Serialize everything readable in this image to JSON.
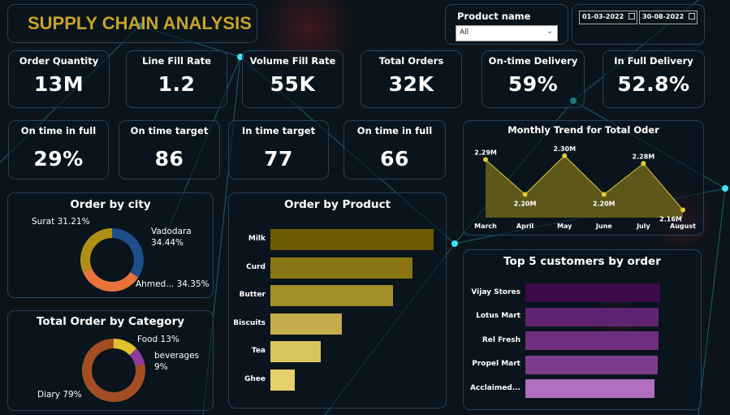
{
  "header": {
    "title": "SUPPLY CHAIN ANALYSIS"
  },
  "filter": {
    "label": "Product name",
    "value": "All"
  },
  "dates": {
    "start": "01-03-2022",
    "end": "30-08-2022"
  },
  "kpis_top": [
    {
      "title": "Order Quantity",
      "value": "13M"
    },
    {
      "title": "Line Fill Rate",
      "value": "1.2"
    },
    {
      "title": "Volume Fill Rate",
      "value": "55K"
    },
    {
      "title": "Total Orders",
      "value": "32K"
    },
    {
      "title": "On-time Delivery",
      "value": "59%"
    },
    {
      "title": "In Full Delivery",
      "value": "52.8%"
    }
  ],
  "kpis_bottom": [
    {
      "title": "On time in full",
      "value": "29%"
    },
    {
      "title": "On time target",
      "value": "86"
    },
    {
      "title": "In time target",
      "value": "77"
    },
    {
      "title": "On time in full",
      "value": "66"
    }
  ],
  "colors": {
    "title_gold": "#c9a227",
    "yellow": "#d8c547",
    "purple": "#9b4fa0"
  },
  "chart_data": [
    {
      "type": "area",
      "title": "Monthly Trend for Total Oder",
      "categories": [
        "March",
        "April",
        "May",
        "June",
        "July",
        "August"
      ],
      "values": [
        2.29,
        2.2,
        2.3,
        2.2,
        2.28,
        2.16
      ],
      "data_labels": [
        "2.29M",
        "2.20M",
        "2.30M",
        "2.20M",
        "2.28M",
        "2.16M"
      ],
      "ylim": [
        2.14,
        2.31
      ]
    },
    {
      "type": "pie",
      "title": "Order by city",
      "slices": [
        {
          "label": "Vadodara",
          "pct": "34.44%",
          "value": 34.44,
          "color": "#1e4f8b"
        },
        {
          "label": "Ahmed...",
          "pct": "34.35%",
          "value": 34.35,
          "color": "#e8733a"
        },
        {
          "label": "Surat",
          "pct": "31.21%",
          "value": 31.21,
          "color": "#b18f14"
        }
      ]
    },
    {
      "type": "pie",
      "title": "Total Order by Category",
      "slices": [
        {
          "label": "Food",
          "pct": "13%",
          "value": 13,
          "color": "#e0c22e"
        },
        {
          "label": "beverages",
          "pct": "9%",
          "value": 9,
          "color": "#8e3b9c"
        },
        {
          "label": "Diary",
          "pct": "79%",
          "value": 79,
          "color": "#a44d22"
        }
      ]
    },
    {
      "type": "bar",
      "title": "Order by Product",
      "categories": [
        "Milk",
        "Curd",
        "Butter",
        "Biscuits",
        "Tea",
        "Ghee"
      ],
      "values": [
        100,
        87,
        75,
        44,
        31,
        15
      ],
      "colors": [
        "#6e5a00",
        "#8a7416",
        "#a38e28",
        "#c4ad4a",
        "#d9c35e",
        "#e6d06c"
      ]
    },
    {
      "type": "bar",
      "title": "Top 5 customers by order",
      "categories": [
        "Vijay Stores",
        "Lotus Mart",
        "Rel Fresh",
        "Propel Mart",
        "Acclaimed..."
      ],
      "values": [
        100,
        99,
        99,
        98,
        96
      ],
      "colors": [
        "#3d0a4a",
        "#5e2470",
        "#6e2f7e",
        "#7d3b8c",
        "#b36fbf"
      ]
    }
  ]
}
